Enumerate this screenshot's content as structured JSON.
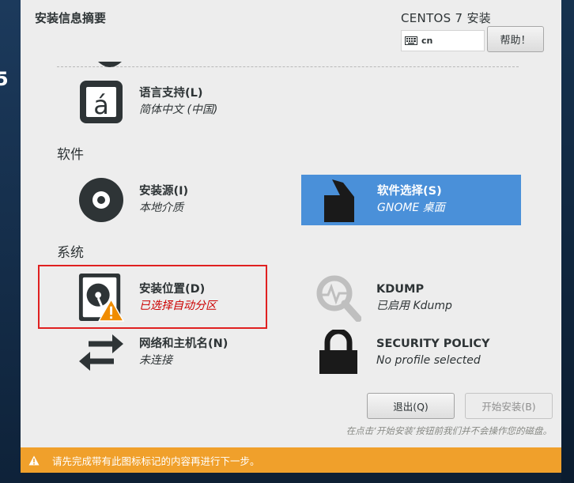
{
  "sidebar": {
    "brand_fragment": "5"
  },
  "header": {
    "page_title": "安装信息摘要",
    "product_title": "CENTOS 7 安装",
    "keyboard_layout": "cn",
    "help_button": "帮助！"
  },
  "sections": {
    "software": "软件",
    "system": "系统"
  },
  "spokes": {
    "language": {
      "title": "语言支持(L)",
      "status": "简体中文 (中国)",
      "icon": "language-icon"
    },
    "source": {
      "title": "安装源(I)",
      "status": "本地介质",
      "icon": "disc-icon"
    },
    "software_selection": {
      "title": "软件选择(S)",
      "status": "GNOME 桌面",
      "icon": "package-icon"
    },
    "destination": {
      "title": "安装位置(D)",
      "status": "已选择自动分区",
      "icon": "harddisk-warning-icon"
    },
    "kdump": {
      "title": "KDUMP",
      "status": "已启用 Kdump",
      "icon": "magnifier-icon"
    },
    "network": {
      "title": "网络和主机名(N)",
      "status": "未连接",
      "icon": "network-arrows-icon"
    },
    "security": {
      "title": "SECURITY POLICY",
      "status": "No profile selected",
      "icon": "lock-icon"
    }
  },
  "buttons": {
    "quit": "退出(Q)",
    "begin_install": "开始安装(B)"
  },
  "hint": "在点击‘开始安装’按钮前我们并不会操作您的磁盘。",
  "warning_bar": {
    "message": "请先完成带有此图标标记的内容再进行下一步。"
  },
  "colors": {
    "selected_spoke": "#4a90d9",
    "warning_bar": "#f0a02b",
    "warning_text": "#cc0000",
    "sidebar": "#1c3a5c"
  }
}
